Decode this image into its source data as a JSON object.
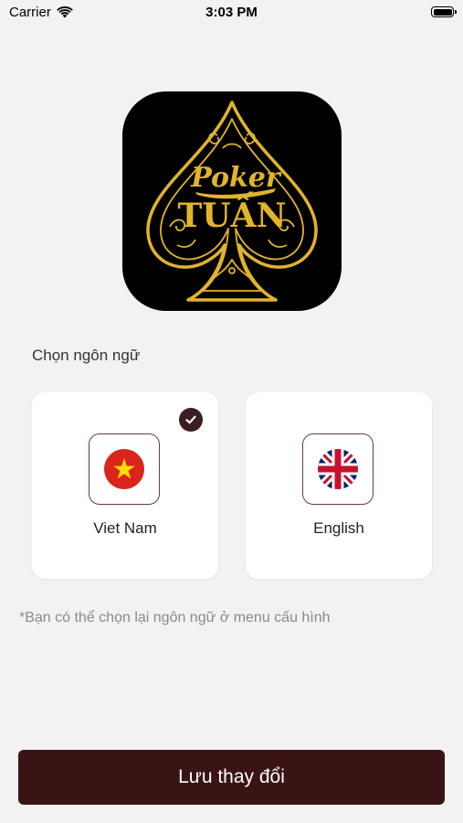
{
  "status_bar": {
    "carrier": "Carrier",
    "time": "3:03 PM"
  },
  "logo": {
    "line1": "Poker",
    "line2": "TUẤN",
    "accent_color": "#e2b42a"
  },
  "language": {
    "label": "Chọn ngôn ngữ",
    "options": [
      {
        "name": "Viet Nam",
        "flag": "vietnam-flag",
        "selected": true
      },
      {
        "name": "English",
        "flag": "uk-flag",
        "selected": false
      }
    ]
  },
  "hint": "*Bạn có thể chọn lại ngôn ngữ ở menu cấu hình",
  "save_button": {
    "label": "Lưu thay đổi"
  },
  "colors": {
    "primary": "#3a1415",
    "background": "#f2f2f2",
    "card": "#ffffff",
    "hint_text": "#8a8a8a"
  }
}
